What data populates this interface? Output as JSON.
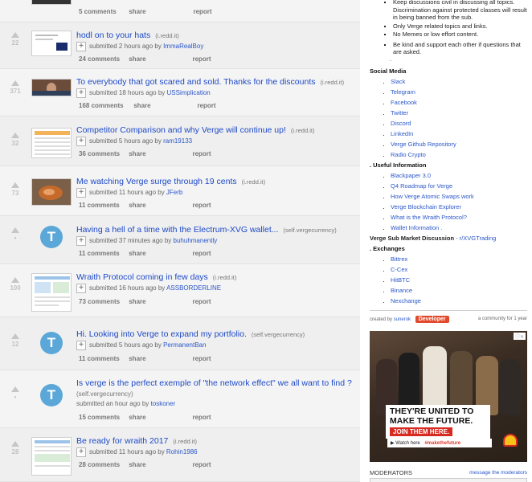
{
  "posts": [
    {
      "score": "",
      "title": "",
      "domain": "",
      "submitted": "",
      "author": "",
      "comments": "5 comments",
      "share": "share",
      "report": "report"
    },
    {
      "score": "22",
      "title": "hodl on to your hats",
      "domain": "(i.redd.it)",
      "submitted": "submitted 2 hours ago by",
      "author": "ImmaRealBoy",
      "comments": "24 comments",
      "share": "share",
      "report": "report"
    },
    {
      "score": "371",
      "title": "To everybody that got scared and sold. Thanks for the discounts",
      "domain": "(i.redd.it)",
      "submitted": "submitted 18 hours ago by",
      "author": "USSimplication",
      "comments": "168 comments",
      "share": "share",
      "report": "report"
    },
    {
      "score": "32",
      "title": "Competitor Comparison and why Verge will continue up!",
      "domain": "(i.redd.it)",
      "submitted": "submitted 5 hours ago by",
      "author": "ram19133",
      "comments": "36 comments",
      "share": "share",
      "report": "report"
    },
    {
      "score": "73",
      "title": "Me watching Verge surge through 19 cents",
      "domain": "(i.redd.it)",
      "submitted": "submitted 11 hours ago by",
      "author": "JFerb",
      "comments": "11 comments",
      "share": "share",
      "report": "report"
    },
    {
      "score": "•",
      "title": "Having a hell of a time with the Electrum-XVG wallet...",
      "domain": "(self.vergecurrency)",
      "submitted": "submitted 37 minutes ago by",
      "author": "buhuhmanently",
      "comments": "11 comments",
      "share": "share",
      "report": "report",
      "self_letter": "T"
    },
    {
      "score": "100",
      "title": "Wraith Protocol coming in few days",
      "domain": "(i.redd.it)",
      "submitted": "submitted 16 hours ago by",
      "author": "ASSBORDERLINE",
      "comments": "73 comments",
      "share": "share",
      "report": "report"
    },
    {
      "score": "12",
      "title": "Hi. Looking into Verge to expand my portfolio.",
      "domain": "(self.vergecurrency)",
      "submitted": "submitted 5 hours ago by",
      "author": "PermanentBan",
      "comments": "11 comments",
      "share": "share",
      "report": "report",
      "self_letter": "T"
    },
    {
      "score": "•",
      "title": "Is verge is the perfect exemple of \"the network effect\" we all want to find ?",
      "domain": "(self.vergecurrency)",
      "submitted": "submitted an hour ago by",
      "author": "toskoner",
      "comments": "15 comments",
      "share": "share",
      "report": "report",
      "self_letter": "T"
    },
    {
      "score": "28",
      "title": "Be ready for wraith 2017",
      "domain": "(i.redd.it)",
      "submitted": "submitted 11 hours ago by",
      "author": "Rohin1986",
      "comments": "28 comments",
      "share": "share",
      "report": "report"
    }
  ],
  "sidebar": {
    "rules": [
      "Keep discussions civil in discussing all topics. Discrimination against protected classes will result in being banned from the sub.",
      "Only Verge related topics and links.",
      "No Memes or low effort content.",
      "Be kind and support each other if questions that are asked."
    ],
    "dot": ".",
    "social_heading": "Social Media",
    "social_links": [
      "Slack",
      "Telegram",
      "Facebook",
      "Twitter",
      "Discord",
      "LinkedIn",
      "Verge Github Repository",
      "Radio Crypto"
    ],
    "useful_heading": ". Useful Information",
    "useful_links": [
      "Blackpaper 3.0",
      "Q4 Roadmap for Verge",
      "How Verge Atomic Swaps work",
      "Verge Blockchain Explorer",
      "What is the Wraith Protocol?",
      "Wallet Information ."
    ],
    "subdisc_label": "Verge Sub Market Discussion",
    "subdisc_link": "- r/XVGTrading",
    "exchanges_heading": ". Exchanges",
    "exchanges": [
      "Bittrex",
      "C-Cex",
      "HitBTC",
      "Binance",
      "Nexchange"
    ],
    "created_by": "created by",
    "creator": "sunerok",
    "developer": "Developer",
    "community_age": "a community for 1 year",
    "ad": {
      "line1": "THEY'RE UNITED TO MAKE THE FUTURE.",
      "cta": "JOIN THEM HERE.",
      "watch": "Watch here",
      "hashtag": "#makethefuture"
    },
    "moderators_heading": "MODERATORS",
    "message_mods": "message the moderators"
  },
  "colors": {
    "link": "#1d49c7",
    "accent": "#e14a2c",
    "self_thumb": "#5aa7d8"
  }
}
